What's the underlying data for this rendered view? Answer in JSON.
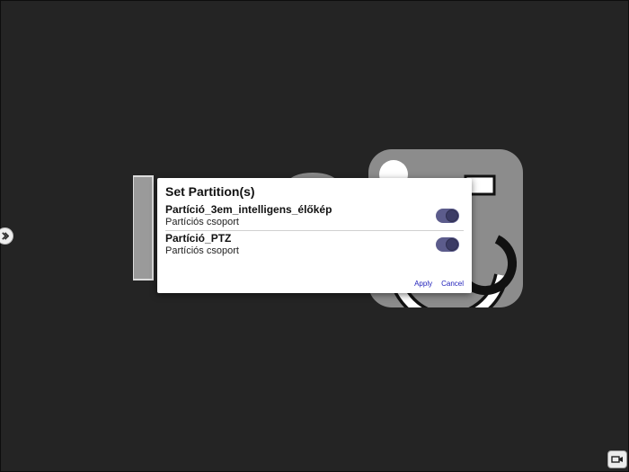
{
  "dialog": {
    "title": "Set Partition(s)",
    "items": [
      {
        "name": "Partíció_3em_intelligens_élőkép",
        "subtitle": "Partíciós csoport",
        "enabled": true
      },
      {
        "name": "Partíció_PTZ",
        "subtitle": "Partíciós csoport",
        "enabled": true
      }
    ],
    "apply_label": "Apply",
    "cancel_label": "Cancel"
  },
  "icons": {
    "side_handle": "chevron-right-icon",
    "corner_button": "camera-switch-icon"
  },
  "colors": {
    "background": "#242424",
    "toggle_track": "#5c5c8c",
    "toggle_knob": "#3c3c66",
    "action_text": "#2222bb"
  }
}
